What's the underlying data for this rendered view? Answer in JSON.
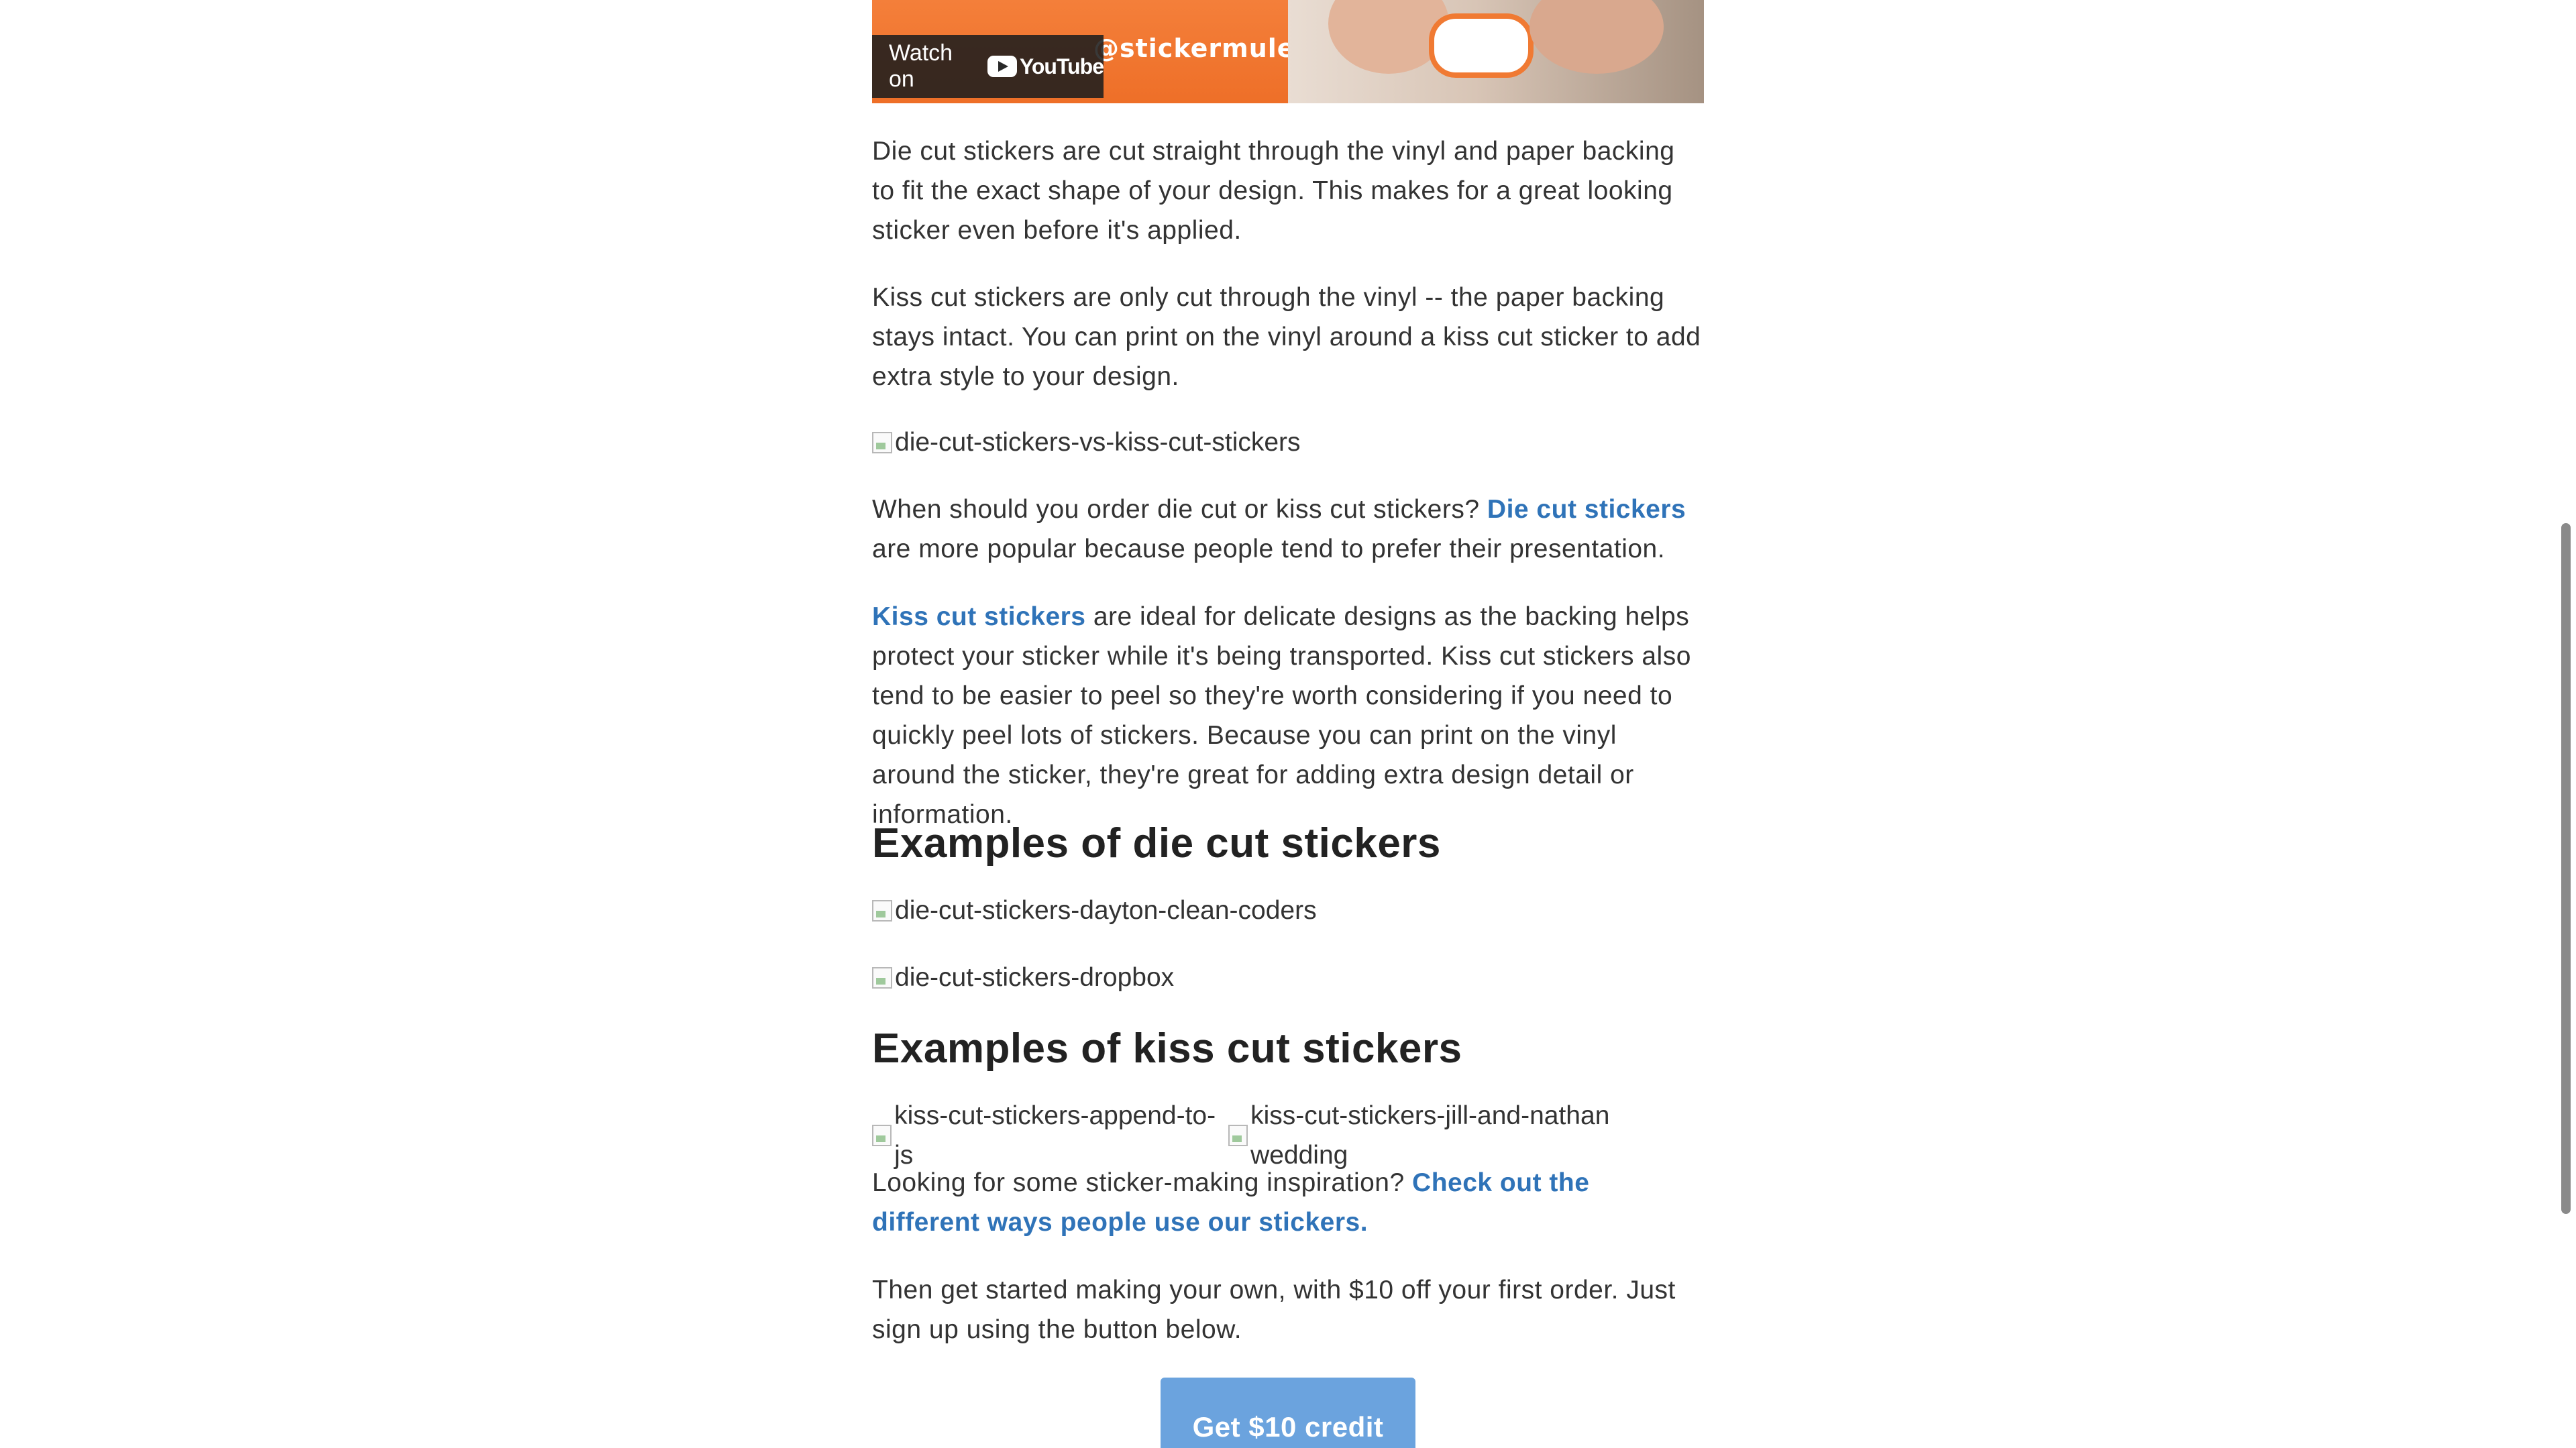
{
  "video": {
    "watch_on_label": "Watch on",
    "youtube_label": "YouTube",
    "brand_text": "stickermule"
  },
  "paragraphs": {
    "die_cut_desc": "Die cut stickers are cut straight through the vinyl and paper backing to fit the exact shape of your design. This makes for a great looking sticker even before it's applied.",
    "kiss_cut_desc": "Kiss cut stickers are only cut through the vinyl -- the paper backing stays intact. You can print on the vinyl around a kiss cut sticker to add extra style to your design.",
    "when_order_before": "When should you order die cut or kiss cut stickers?",
    "when_order_link": "Die cut stickers",
    "when_order_after": "are more popular because people tend to prefer their presentation.",
    "kiss_link": "Kiss cut stickers",
    "kiss_after": "are ideal for delicate designs as the backing helps protect your sticker while it's being transported. Kiss cut stickers also tend to be easier to peel so they're worth considering if you need to quickly peel lots of stickers. Because you can print on the vinyl around the sticker, they're great for adding extra design detail or information.",
    "inspiration_before": "Looking for some sticker-making inspiration?",
    "inspiration_link": "Check out the different ways people use our stickers.",
    "signup_text": "Then get started making your own, with $10 off your first order. Just sign up using the button below."
  },
  "images": {
    "vs": "die-cut-stickers-vs-kiss-cut-stickers",
    "dayton": "die-cut-stickers-dayton-clean-coders",
    "dropbox": "die-cut-stickers-dropbox",
    "append": "kiss-cut-stickers-append-to-js",
    "wedding": "kiss-cut-stickers-jill-and-nathan wedding"
  },
  "headings": {
    "die_examples": "Examples of die cut stickers",
    "kiss_examples": "Examples of kiss cut stickers"
  },
  "cta": {
    "label": "Get $10 credit"
  },
  "colors": {
    "link": "#2f73b8",
    "button": "#6ba3de",
    "video_orange": "#f07a33"
  }
}
